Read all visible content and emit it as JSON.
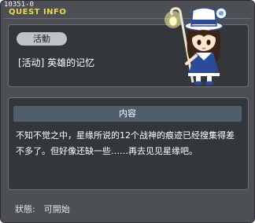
{
  "window": {
    "id_code": "10351-0",
    "title": "QUEST INFO"
  },
  "quest": {
    "category": "活動",
    "name": "[活动] 英雄的记忆"
  },
  "details": {
    "header": "内容",
    "text": "不知不觉之中，星缘所说的12个战神的痕迹已经搜集得差不多了。但好像还缺一些……再去见见星缘吧。"
  },
  "status": {
    "text": "狀態:　可開始"
  },
  "npc": {
    "icon": "girl-with-lantern-staff-icon"
  },
  "colors": {
    "title": "#e8d84a",
    "panel": "#33373b",
    "window": "#4c5054",
    "detail_header": "#4e5f6a"
  }
}
